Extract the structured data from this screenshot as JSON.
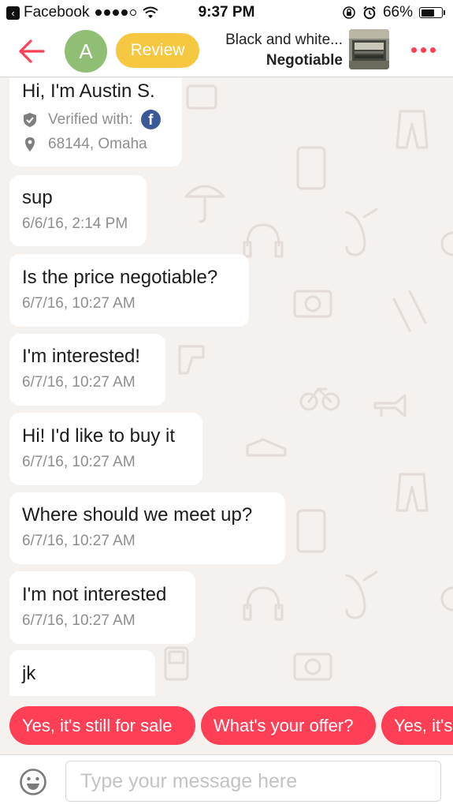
{
  "status_bar": {
    "back_app": "Facebook",
    "time": "9:37 PM",
    "battery": "66%",
    "battery_level": 0.66
  },
  "header": {
    "avatar_letter": "A",
    "review_label": "Review",
    "listing_title": "Black and white...",
    "listing_price": "Negotiable"
  },
  "profile": {
    "name": "Hi, I'm Austin S.",
    "verified_label": "Verified with:",
    "verified_badge": "f",
    "location": "68144, Omaha"
  },
  "messages": [
    {
      "text": "sup",
      "time": "6/6/16, 2:14 PM"
    },
    {
      "text": "Is the price negotiable?",
      "time": "6/7/16, 10:27 AM"
    },
    {
      "text": "I'm interested!",
      "time": "6/7/16, 10:27 AM"
    },
    {
      "text": "Hi! I'd like to buy it",
      "time": "6/7/16, 10:27 AM"
    },
    {
      "text": "Where should we meet up?",
      "time": "6/7/16, 10:27 AM"
    },
    {
      "text": "I'm not interested",
      "time": "6/7/16, 10:27 AM"
    },
    {
      "text": "jk"
    }
  ],
  "quick_replies": [
    "Yes, it's still for sale",
    "What's your offer?",
    "Yes, it's"
  ],
  "composer": {
    "placeholder": "Type your message here"
  },
  "colors": {
    "accent": "#ff3f55",
    "review": "#f6c842",
    "avatar": "#8fbe74",
    "chat_background": "#f5f1ee",
    "facebook": "#3b5998"
  },
  "icons": {
    "back": "arrow-left-icon",
    "more": "more-horizontal-icon",
    "verified": "shield-check-icon",
    "location": "map-pin-icon",
    "emoji": "smiley-icon"
  }
}
